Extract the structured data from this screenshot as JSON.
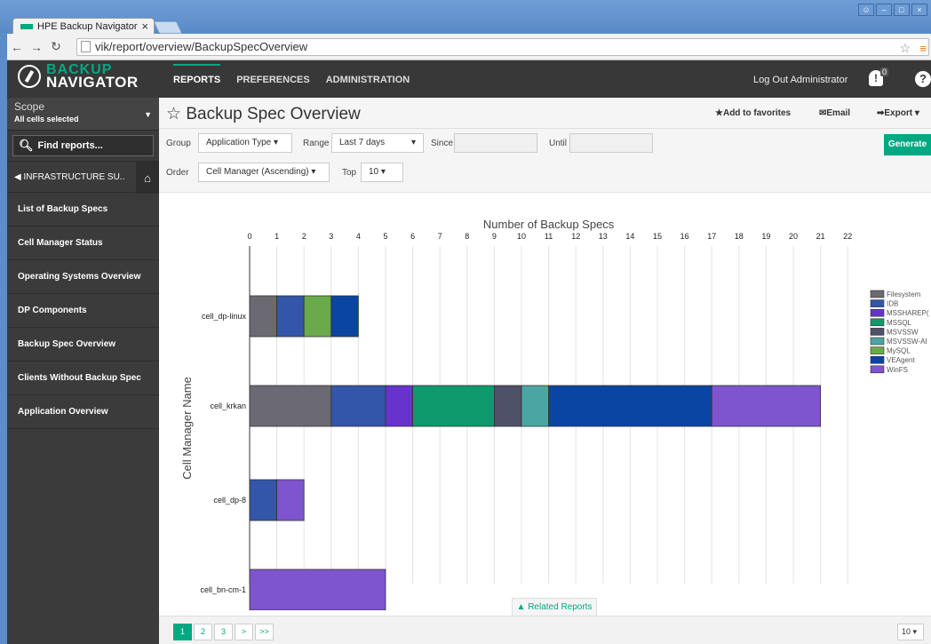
{
  "browser": {
    "tab_title": "HPE Backup Navigator",
    "tab_close": "×",
    "url": "vik/report/overview/BackupSpecOverview"
  },
  "app": {
    "logo_line1": "BACKUP",
    "logo_line2": "NAVIGATOR",
    "nav": [
      "REPORTS",
      "PREFERENCES",
      "ADMINISTRATION"
    ],
    "logout": "Log Out Administrator",
    "notif_count": "0",
    "help": "?"
  },
  "sidebar": {
    "scope_title": "Scope",
    "scope_value": "All cells selected",
    "find_label": "Find reports...",
    "infra_label": "INFRASTRUCTURE SU..",
    "items": [
      "List of Backup Specs",
      "Cell Manager Status",
      "Operating Systems Overview",
      "DP Components",
      "Backup Spec Overview",
      "Clients Without Backup Spec",
      "Application Overview"
    ]
  },
  "header": {
    "title": "Backup Spec Overview",
    "favorites": "Add to favorites",
    "email": "Email",
    "export": "Export"
  },
  "filters": {
    "group_label": "Group",
    "group_value": "Application Type",
    "range_label": "Range",
    "range_value": "Last 7 days",
    "since_label": "Since",
    "until_label": "Until",
    "order_label": "Order",
    "order_value": "Cell Manager (Ascending)",
    "top_label": "Top",
    "top_value": "10",
    "generate": "Generate"
  },
  "chart_data": {
    "type": "bar",
    "orientation": "horizontal",
    "stacked": true,
    "title": "Number of Backup Specs",
    "ylabel": "Cell Manager Name",
    "xlim": [
      0,
      22
    ],
    "x_ticks": [
      0,
      1,
      2,
      3,
      4,
      5,
      6,
      7,
      8,
      9,
      10,
      11,
      12,
      13,
      14,
      15,
      16,
      17,
      18,
      19,
      20,
      21,
      22
    ],
    "categories": [
      "cell_dp-linux",
      "cell_krkan",
      "cell_dp-8",
      "cell_bn-cm-1"
    ],
    "series": [
      {
        "name": "Filesystem",
        "color": "#6b6a72",
        "values": [
          1,
          3,
          0,
          0
        ]
      },
      {
        "name": "IDB",
        "color": "#3355aa",
        "values": [
          1,
          2,
          1,
          0
        ]
      },
      {
        "name": "MSSHAREPOINT",
        "color": "#6633cc",
        "values": [
          0,
          1,
          0,
          0
        ]
      },
      {
        "name": "MSSQL",
        "color": "#0f9a6e",
        "values": [
          0,
          3,
          0,
          0
        ]
      },
      {
        "name": "MSVSSW",
        "color": "#4e5168",
        "values": [
          0,
          1,
          0,
          0
        ]
      },
      {
        "name": "MSVSSW-APP",
        "color": "#4aa6a2",
        "values": [
          0,
          1,
          0,
          0
        ]
      },
      {
        "name": "MySQL",
        "color": "#6aaa4a",
        "values": [
          1,
          0,
          0,
          0
        ]
      },
      {
        "name": "VEAgent",
        "color": "#0a45a3",
        "values": [
          1,
          6,
          0,
          0
        ]
      },
      {
        "name": "WinFS",
        "color": "#7e54cf",
        "values": [
          0,
          4,
          1,
          5
        ]
      }
    ],
    "legend_labels": [
      "Filesystem",
      "IDB",
      "MSSHAREP(",
      "MSSQL",
      "MSVSSW",
      "MSVSSW-AI",
      "MySQL",
      "VEAgent",
      "WinFS"
    ],
    "grid": true,
    "legend_position": "right"
  },
  "footer": {
    "related": "Related Reports",
    "pages": [
      "1",
      "2",
      "3",
      ">",
      ">>"
    ],
    "page_size": "10"
  }
}
